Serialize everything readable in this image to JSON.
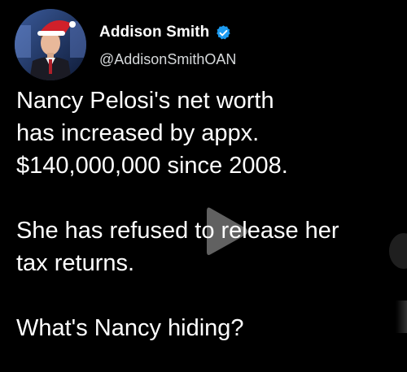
{
  "tweet": {
    "author": {
      "display_name": "Addison Smith",
      "handle": "@AddisonSmithOAN",
      "verified": true,
      "verified_icon": "verified-badge-icon",
      "verified_color": "#1d9bf0"
    },
    "body": {
      "paragraph_1_line_1": "Nancy Pelosi's net worth",
      "paragraph_1_line_2": "has increased by appx.",
      "paragraph_1_line_3": "$140,000,000 since 2008.",
      "paragraph_2_line_1": "She has refused to release her",
      "paragraph_2_line_2": "tax returns.",
      "paragraph_3_line_1": "What's Nancy hiding?"
    },
    "overlay": {
      "icon": "play-icon"
    }
  }
}
